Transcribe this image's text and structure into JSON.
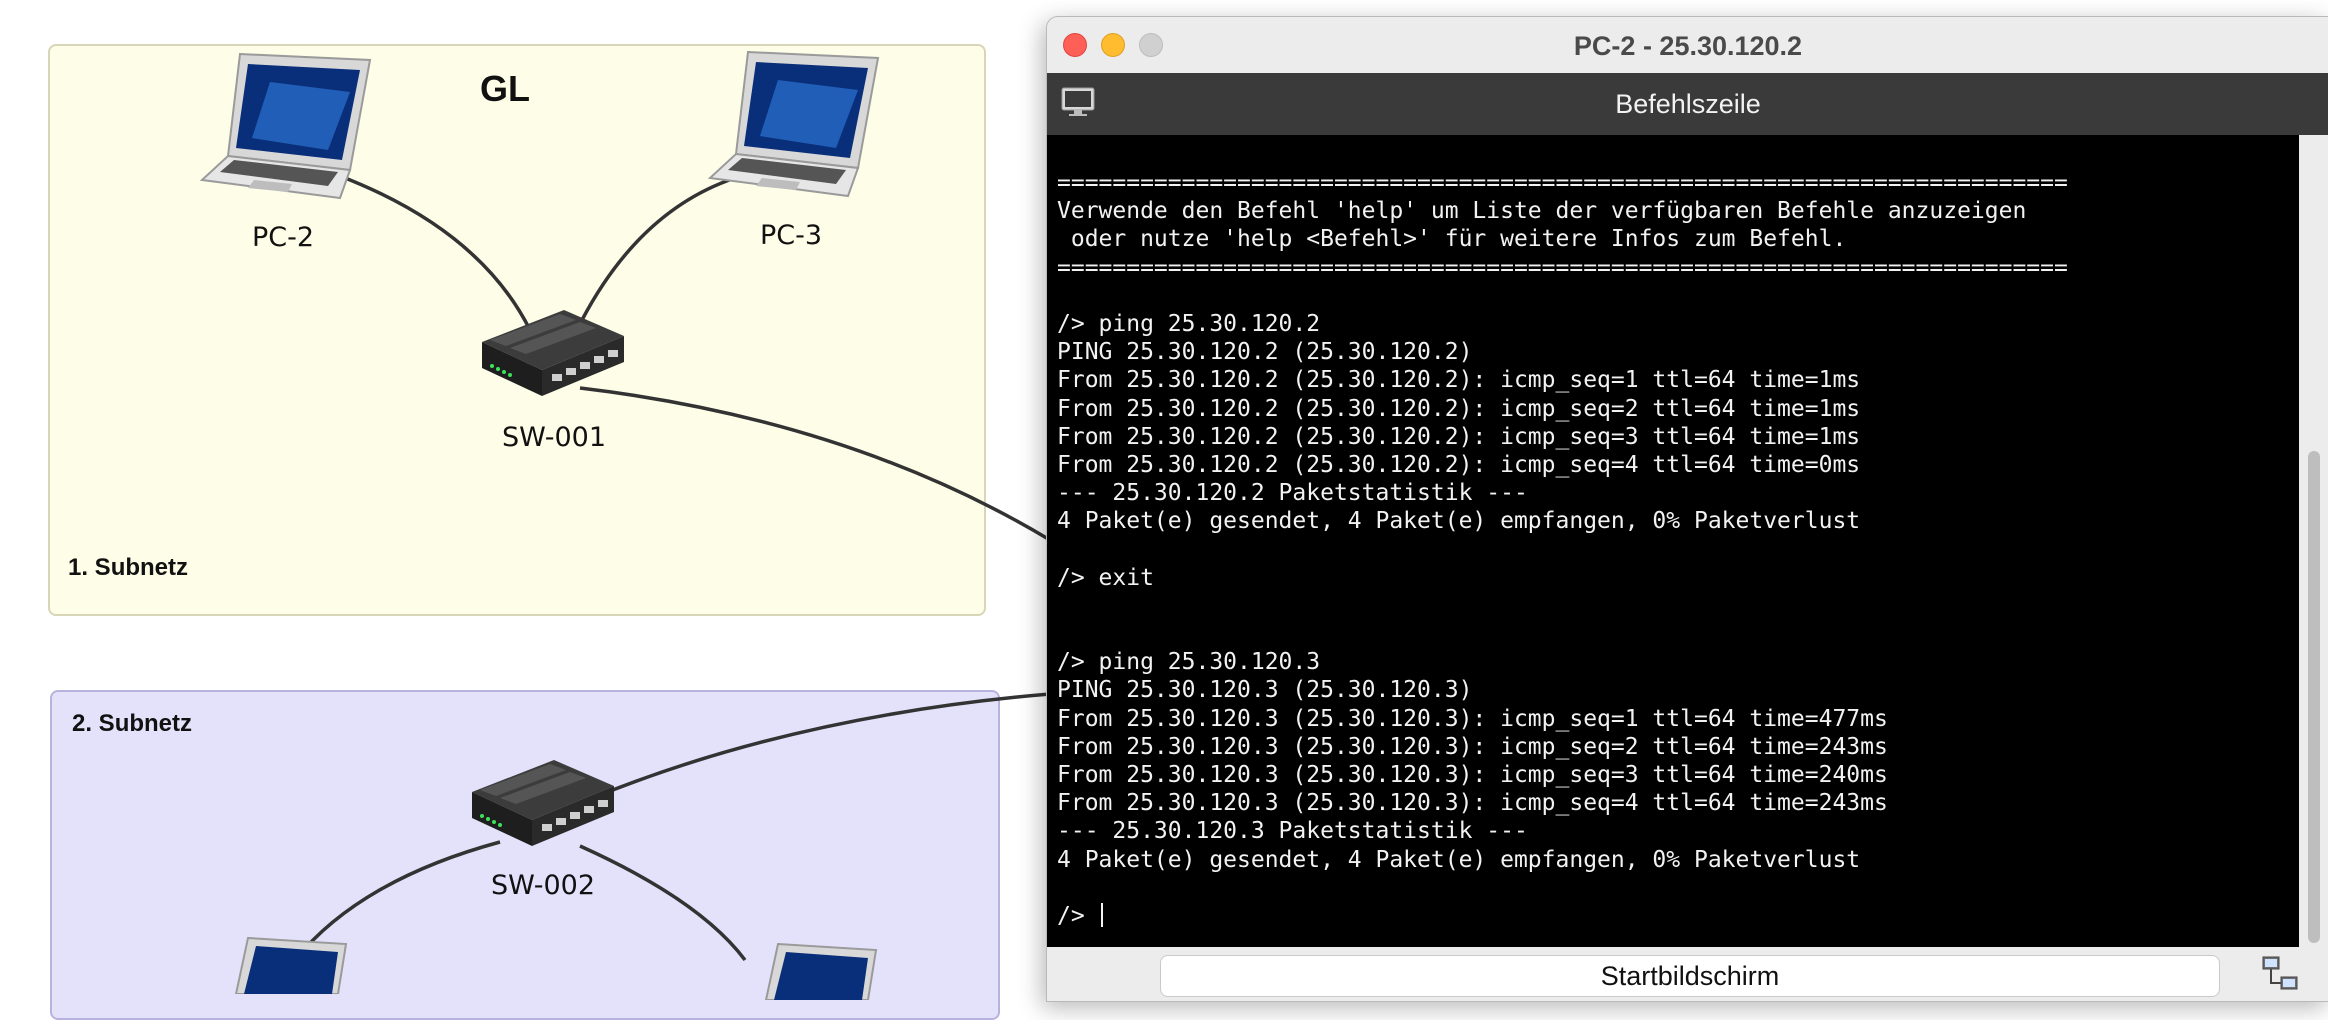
{
  "network": {
    "group_title": "GL",
    "subnets": [
      {
        "label": "1. Subnetz"
      },
      {
        "label": "2. Subnetz"
      }
    ],
    "devices": {
      "pc2": "PC-2",
      "pc3": "PC-3",
      "sw001": "SW-001",
      "sw002": "SW-002"
    }
  },
  "window": {
    "title": "PC-2 - 25.30.120.2",
    "toolbar_title": "Befehlszeile",
    "home_button_label": "Startbildschirm"
  },
  "console": {
    "lines": [
      "=========================================================================",
      "Verwende den Befehl 'help' um Liste der verfügbaren Befehle anzuzeigen",
      " oder nutze 'help <Befehl>' für weitere Infos zum Befehl.",
      "=========================================================================",
      "",
      "/> ping 25.30.120.2",
      "PING 25.30.120.2 (25.30.120.2)",
      "From 25.30.120.2 (25.30.120.2): icmp_seq=1 ttl=64 time=1ms",
      "From 25.30.120.2 (25.30.120.2): icmp_seq=2 ttl=64 time=1ms",
      "From 25.30.120.2 (25.30.120.2): icmp_seq=3 ttl=64 time=1ms",
      "From 25.30.120.2 (25.30.120.2): icmp_seq=4 ttl=64 time=0ms",
      "--- 25.30.120.2 Paketstatistik ---",
      "4 Paket(e) gesendet, 4 Paket(e) empfangen, 0% Paketverlust",
      "",
      "/> exit",
      "",
      "",
      "/> ping 25.30.120.3",
      "PING 25.30.120.3 (25.30.120.3)",
      "From 25.30.120.3 (25.30.120.3): icmp_seq=1 ttl=64 time=477ms",
      "From 25.30.120.3 (25.30.120.3): icmp_seq=2 ttl=64 time=243ms",
      "From 25.30.120.3 (25.30.120.3): icmp_seq=3 ttl=64 time=240ms",
      "From 25.30.120.3 (25.30.120.3): icmp_seq=4 ttl=64 time=243ms",
      "--- 25.30.120.3 Paketstatistik ---",
      "4 Paket(e) gesendet, 4 Paket(e) empfangen, 0% Paketverlust",
      ""
    ],
    "prompt": "/> "
  },
  "icons": {
    "close": "close-button",
    "minimize": "minimize-button",
    "zoom": "zoom-button",
    "toolbar": "monitor-icon",
    "bottom": "network-icon"
  },
  "colors": {
    "subnet1_bg": "#fdfde8",
    "subnet2_bg": "#e4e1fb",
    "terminal_bg": "#000000",
    "terminal_fg": "#f2f2f2",
    "toolbar_bg": "#3a3a3a"
  }
}
